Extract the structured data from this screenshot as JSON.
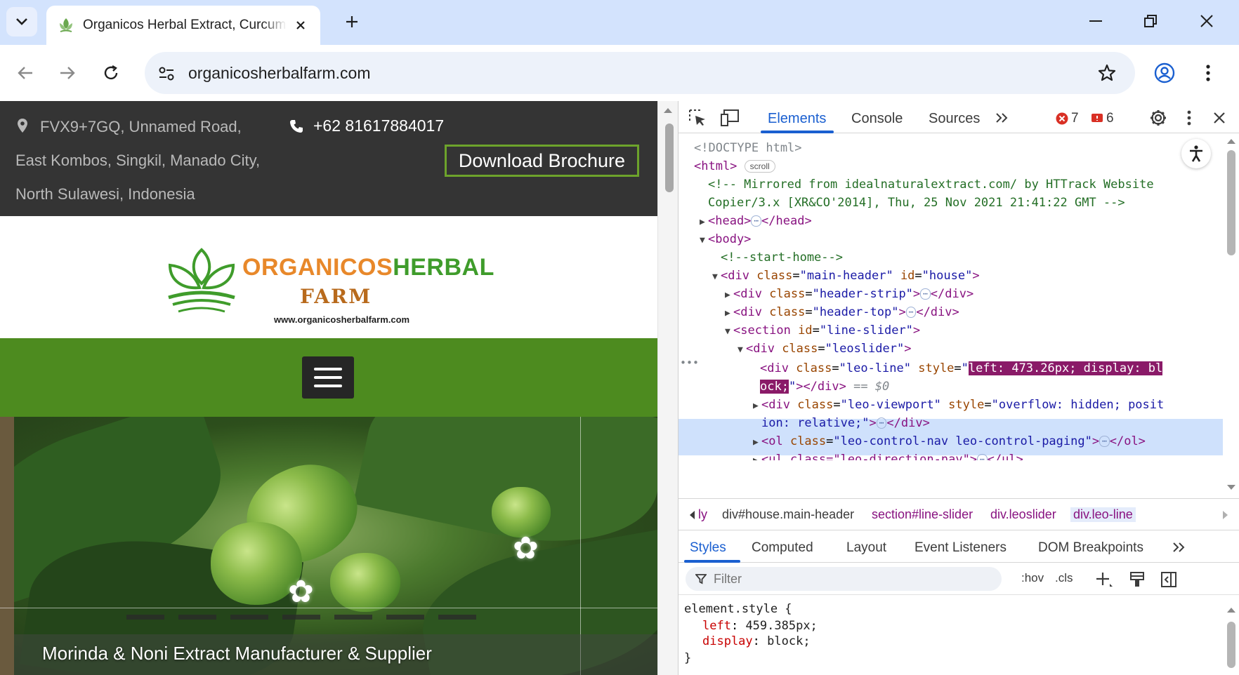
{
  "browser": {
    "tab_title": "Organicos Herbal Extract, Curcuma",
    "url": "organicosherbalfarm.com"
  },
  "page": {
    "address_line1": "FVX9+7GQ, Unnamed Road,",
    "address_line2": "East Kombos, Singkil, Manado City,",
    "address_line3": "North Sulawesi, Indonesia",
    "phone": "+62 81617884017",
    "brochure_label": "Download Brochure",
    "logo_word_orange": "ORGANICOS",
    "logo_word_green": "HERBAL",
    "logo_word_farm": "FARM",
    "logo_url": "www.organicosherbalfarm.com",
    "slider_caption": "Morinda & Noni Extract Manufacturer & Supplier"
  },
  "devtools": {
    "tabs": [
      "Elements",
      "Console",
      "Sources"
    ],
    "error_count": "7",
    "warning_count": "6",
    "dom": {
      "doctype": "<!DOCTYPE html>",
      "html_open": "<html>",
      "scroll_badge": "scroll",
      "comment_line1": "<!-- Mirrored from idealnaturalextract.com/ by HTTrack Website",
      "comment_line2": "Copier/3.x [XR&CO'2014], Thu, 25 Nov 2021 21:41:22 GMT -->",
      "head_open": "<head>",
      "head_close": "</head>",
      "body_open": "<body>",
      "start_home": "<!--start-home-->",
      "main_header_tag": "<div ",
      "main_header_attr1": "class",
      "main_header_val1": "\"main-header\"",
      "main_header_attr2": "id",
      "main_header_val2": "\"house\"",
      "header_strip_val": "\"header-strip\"",
      "header_top_val": "\"header-top\"",
      "section_val": "\"line-slider\"",
      "leoslider_val": "\"leoslider\"",
      "leoline_val": "\"leo-line\"",
      "leoline_style_a": "left: 473.26px; display: bl",
      "leoline_style_b": "ock;",
      "leoline_suffix": "== $0",
      "viewport_val": "\"leo-viewport\"",
      "viewport_style_a": "\"overflow: hidden; posit",
      "viewport_style_b": "ion: relative;\"",
      "controlnav_val": "\"leo-control-nav leo-control-paging\"",
      "directionnav_partial": "<ul class=\"leo-direction-nav\">",
      "close_div": "</div>",
      "close_ol": "</ol>",
      "close_ul": "</ul>",
      "attr_class": "class",
      "attr_style": "style",
      "attr_id": "id",
      "ellipsis": "⋯"
    },
    "breadcrumbs": [
      "ly",
      "div#house.main-header",
      "section#line-slider",
      "div.leoslider",
      "div.leo-line"
    ],
    "sub_tabs": [
      "Styles",
      "Computed",
      "Layout",
      "Event Listeners",
      "DOM Breakpoints"
    ],
    "filter_placeholder": "Filter",
    "hov_label": ":hov",
    "cls_label": ".cls",
    "styles": {
      "selector": "element.style {",
      "prop1": "left",
      "val1": "459.385px;",
      "prop2": "display",
      "val2": "block;",
      "close": "}"
    }
  },
  "colors": {
    "accent_blue": "#1a5fd0",
    "nav_green": "#4d8b1f",
    "strip_dark": "#343434",
    "highlight_magenta": "#8a1a68"
  }
}
